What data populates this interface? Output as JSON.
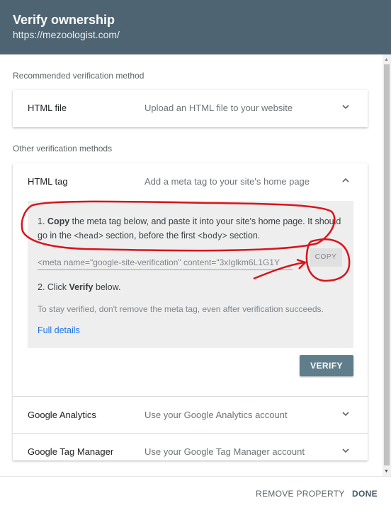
{
  "header": {
    "title": "Verify ownership",
    "url": "https://mezoologist.com/"
  },
  "recommended": {
    "section_label": "Recommended verification method",
    "method": {
      "name": "HTML file",
      "description": "Upload an HTML file to your website",
      "icon": "chevron-down-icon"
    }
  },
  "other": {
    "section_label": "Other verification methods",
    "html_tag": {
      "name": "HTML tag",
      "description": "Add a meta tag to your site's home page",
      "icon": "chevron-up-icon",
      "step1": {
        "number": "1.",
        "bold": "Copy",
        "text_a": " the meta tag below, and paste it into your site's home page. It should go in the ",
        "code_head": "<head>",
        "text_b": " section, before the first ",
        "code_body": "<body>",
        "text_c": " section."
      },
      "meta_value": "<meta name=\"google-site-verification\" content=\"3xIglkm6L1G1Y",
      "copy_label": "COPY",
      "step2": {
        "number": "2. Click ",
        "bold": "Verify",
        "text": " below."
      },
      "note": "To stay verified, don't remove the meta tag, even after verification succeeds.",
      "full_details": "Full details",
      "verify_label": "VERIFY"
    },
    "methods": [
      {
        "name": "Google Analytics",
        "description": "Use your Google Analytics account",
        "icon": "chevron-down-icon"
      },
      {
        "name": "Google Tag Manager",
        "description": "Use your Google Tag Manager account",
        "icon": "chevron-down-icon"
      }
    ]
  },
  "footer": {
    "remove_label": "REMOVE PROPERTY",
    "done_label": "DONE"
  },
  "colors": {
    "header_bg": "#4f6472",
    "verify_bg": "#607d8b",
    "link": "#1a73e8",
    "annotation": "#d8141c"
  }
}
